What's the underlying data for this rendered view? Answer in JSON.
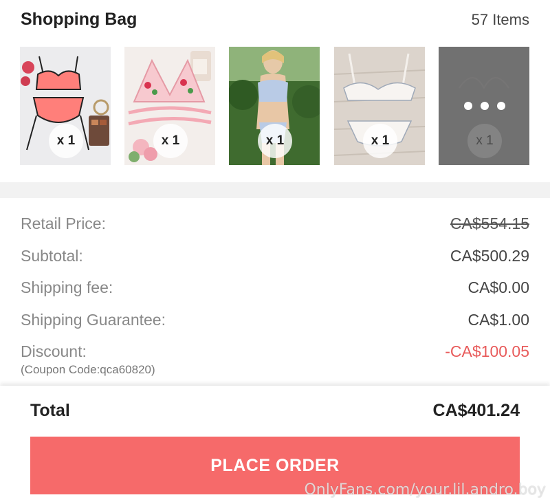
{
  "header": {
    "title": "Shopping Bag",
    "item_count": "57 Items"
  },
  "thumbnails": [
    {
      "name": "pink-garter-lingerie-set",
      "quantity": "x 1"
    },
    {
      "name": "floral-embroidered-bralette-set",
      "quantity": "x 1"
    },
    {
      "name": "blue-lace-lingerie-model",
      "quantity": "x 1"
    },
    {
      "name": "white-lace-bra-set",
      "quantity": "x 1"
    },
    {
      "name": "more-items",
      "quantity": "x 1"
    }
  ],
  "summary": {
    "retail_price_label": "Retail Price:",
    "retail_price_value": "CA$554.15",
    "subtotal_label": "Subtotal:",
    "subtotal_value": "CA$500.29",
    "shipping_fee_label": "Shipping fee:",
    "shipping_fee_value": "CA$0.00",
    "shipping_guarantee_label": "Shipping Guarantee:",
    "shipping_guarantee_value": "CA$1.00",
    "discount_label": "Discount:",
    "discount_value": "-CA$100.05",
    "coupon_note": "(Coupon Code:qca60820)"
  },
  "footer": {
    "total_label": "Total",
    "total_value": "CA$401.24",
    "place_order_label": "PLACE ORDER"
  },
  "watermark": "OnlyFans.com/your.lil.andro.boy",
  "colors": {
    "accent": "#f66a6a",
    "discount": "#e85a5a",
    "divider": "#f2f2f2"
  }
}
